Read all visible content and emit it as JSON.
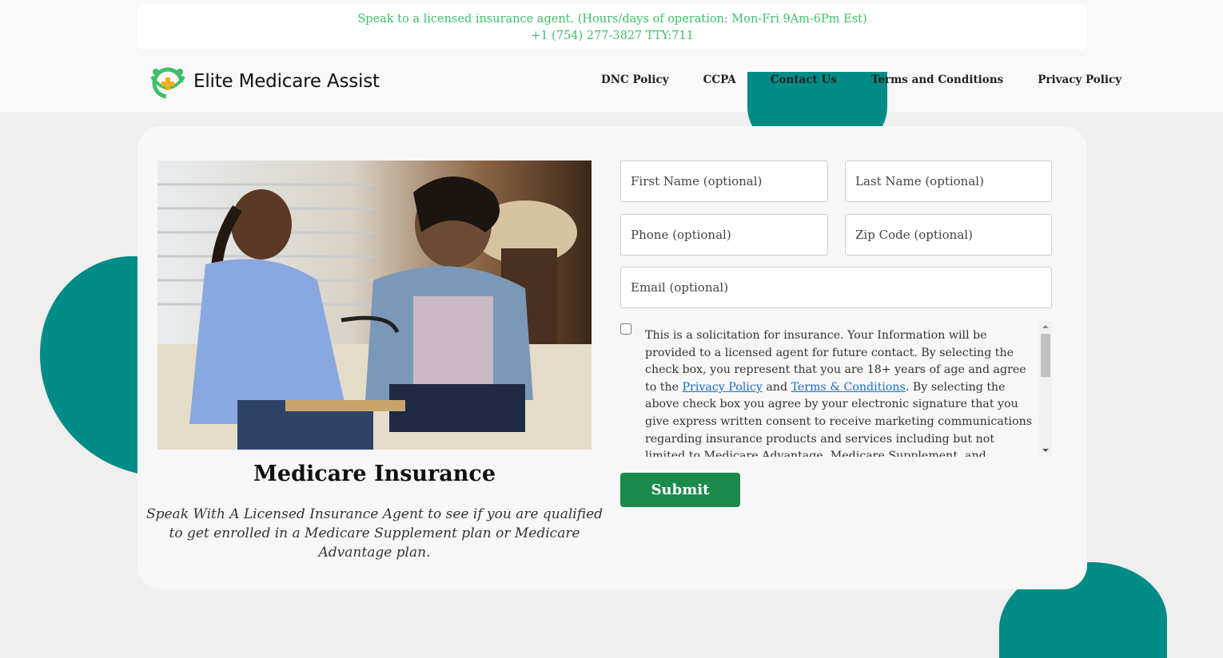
{
  "banner": {
    "line1": "Speak to a licensed insurance agent. (Hours/days of operation: Mon-Fri 9Am-6Pm Est)",
    "line2": "+1 (754) 277-3827 TTY:711"
  },
  "brand": {
    "name": "Elite Medicare Assist",
    "logo_icon": "medical-people-logo-icon",
    "accent_color": "#3fbf6a",
    "teal_color": "#008c86",
    "button_color": "#1b8a4d"
  },
  "nav": {
    "items": [
      {
        "label": "DNC Policy"
      },
      {
        "label": "CCPA"
      },
      {
        "label": "Contact Us"
      },
      {
        "label": "Terms and Conditions"
      },
      {
        "label": "Privacy Policy"
      }
    ]
  },
  "hero": {
    "title": "Medicare Insurance",
    "subtitle": "Speak With A Licensed Insurance Agent to see if you are qualified to get enrolled in a Medicare Supplement plan or Medicare Advantage plan."
  },
  "form": {
    "first_name_placeholder": "First Name (optional)",
    "last_name_placeholder": "Last Name (optional)",
    "phone_placeholder": "Phone (optional)",
    "zip_placeholder": "Zip Code (optional)",
    "email_placeholder": "Email (optional)",
    "consent_checked": false,
    "consent_part1": "This is a solicitation for insurance. Your Information will be provided to a licensed agent for future contact. By selecting the check box, you represent that you are 18+ years of age and agree to the ",
    "privacy_link": "Privacy Policy",
    "consent_and": " and ",
    "terms_link": "Terms & Conditions",
    "consent_part2": ". By selecting the above check box you agree by your electronic signature that you give express written consent to receive marketing communications regarding insurance products and services including but not limited to Medicare Advantage, Medicare Supplement, and Prescription Drug plans through the use by",
    "submit_label": "Submit"
  }
}
